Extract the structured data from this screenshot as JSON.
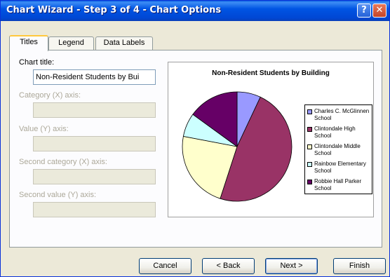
{
  "window": {
    "title": "Chart Wizard - Step 3 of 4 - Chart Options",
    "help_label": "?",
    "close_label": "✕"
  },
  "tabs": [
    {
      "label": "Titles",
      "active": true
    },
    {
      "label": "Legend",
      "active": false
    },
    {
      "label": "Data Labels",
      "active": false
    }
  ],
  "fields": {
    "chart_title": {
      "label": "Chart title:",
      "value": "Non-Resident Students by Bui"
    },
    "category_x": {
      "label": "Category (X) axis:",
      "value": ""
    },
    "value_y": {
      "label": "Value (Y) axis:",
      "value": ""
    },
    "second_category_x": {
      "label": "Second category (X) axis:",
      "value": ""
    },
    "second_value_y": {
      "label": "Second value (Y) axis:",
      "value": ""
    }
  },
  "preview": {
    "legend": [
      {
        "label": "Charles C. McGlinnen School",
        "color": "#9999ff"
      },
      {
        "label": "Clintondale High School",
        "color": "#993366"
      },
      {
        "label": "Clintondale Middle School",
        "color": "#ffffcc"
      },
      {
        "label": "Rainbow Elementary School",
        "color": "#ccffff"
      },
      {
        "label": "Robbie Hall Parker School",
        "color": "#660066"
      }
    ]
  },
  "chart_data": {
    "type": "pie",
    "title": "Non-Resident Students by Building",
    "categories": [
      "Charles C. McGlinnen School",
      "Clintondale High School",
      "Clintondale Middle School",
      "Rainbow Elementary School",
      "Robbie Hall Parker School"
    ],
    "values": [
      7,
      48,
      23,
      7,
      15
    ],
    "colors": [
      "#9999ff",
      "#993366",
      "#ffffcc",
      "#ccffff",
      "#660066"
    ],
    "legend_position": "right"
  },
  "buttons": {
    "cancel": "Cancel",
    "back": "< Back",
    "next": "Next >",
    "finish": "Finish"
  }
}
